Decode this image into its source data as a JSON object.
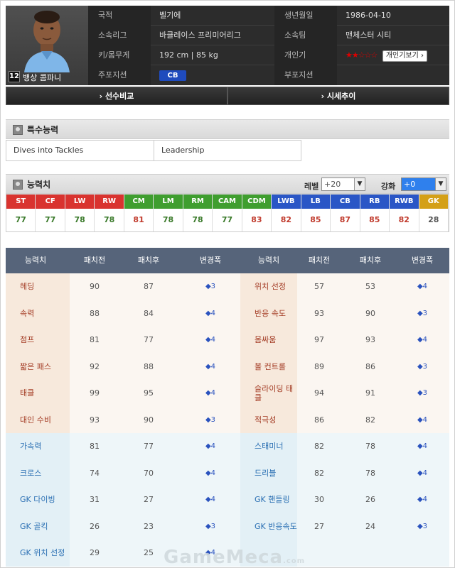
{
  "player": {
    "number": "12",
    "name": "뱅상 콤파니",
    "rows": [
      {
        "label1": "국적",
        "value1": "벨기에",
        "label2": "생년월일",
        "value2": "1986-04-10"
      },
      {
        "label1": "소속리그",
        "value1": "바클레이스 프리미어리그",
        "label2": "소속팀",
        "value2": "맨체스터 시티"
      },
      {
        "label1": "키/몸무게",
        "value1": "192 cm  |  85 kg",
        "label2": "개인기",
        "value2": ""
      },
      {
        "label1": "주포지션",
        "value1": "CB",
        "label2": "부포지션",
        "value2": ""
      }
    ],
    "skill_stars": {
      "filled": "★★",
      "empty": "☆☆☆"
    },
    "personal_skill_button": "개인기보기 ›",
    "compare_button": "› 선수비교",
    "price_button": "› 시세추이"
  },
  "special": {
    "title": "특수능력",
    "items": [
      "Dives into Tackles",
      "Leadership"
    ]
  },
  "ability": {
    "title": "능력치",
    "level_label": "레벨",
    "level_value": "+20",
    "enhance_label": "강화",
    "enhance_value": "+0",
    "positions": [
      {
        "pos": "ST",
        "val": "77",
        "color": "#d9332f",
        "valcolor": "#3a7a2a"
      },
      {
        "pos": "CF",
        "val": "77",
        "color": "#d9332f",
        "valcolor": "#3a7a2a"
      },
      {
        "pos": "LW",
        "val": "78",
        "color": "#d9332f",
        "valcolor": "#3a7a2a"
      },
      {
        "pos": "RW",
        "val": "78",
        "color": "#d9332f",
        "valcolor": "#3a7a2a"
      },
      {
        "pos": "CM",
        "val": "81",
        "color": "#3f9e2f",
        "valcolor": "#c0392b"
      },
      {
        "pos": "LM",
        "val": "78",
        "color": "#3f9e2f",
        "valcolor": "#3a7a2a"
      },
      {
        "pos": "RM",
        "val": "78",
        "color": "#3f9e2f",
        "valcolor": "#3a7a2a"
      },
      {
        "pos": "CAM",
        "val": "77",
        "color": "#3f9e2f",
        "valcolor": "#3a7a2a"
      },
      {
        "pos": "CDM",
        "val": "83",
        "color": "#3f9e2f",
        "valcolor": "#c0392b"
      },
      {
        "pos": "LWB",
        "val": "82",
        "color": "#2a56c6",
        "valcolor": "#c0392b"
      },
      {
        "pos": "LB",
        "val": "85",
        "color": "#2a56c6",
        "valcolor": "#c0392b"
      },
      {
        "pos": "CB",
        "val": "87",
        "color": "#2a56c6",
        "valcolor": "#c0392b"
      },
      {
        "pos": "RB",
        "val": "85",
        "color": "#2a56c6",
        "valcolor": "#c0392b"
      },
      {
        "pos": "RWB",
        "val": "82",
        "color": "#2a56c6",
        "valcolor": "#c0392b"
      },
      {
        "pos": "GK",
        "val": "28",
        "color": "#d4a017",
        "valcolor": "#555555"
      }
    ]
  },
  "stats": {
    "headers": [
      "능력치",
      "패치전",
      "패치후",
      "변경폭",
      "능력치",
      "패치전",
      "패치후",
      "변경폭"
    ],
    "rows": [
      {
        "l": [
          "헤딩",
          "90",
          "87",
          "◆3"
        ],
        "r": [
          "위치 선정",
          "57",
          "53",
          "◆4"
        ],
        "group": "a"
      },
      {
        "l": [
          "속력",
          "88",
          "84",
          "◆4"
        ],
        "r": [
          "반응 속도",
          "93",
          "90",
          "◆3"
        ],
        "group": "a"
      },
      {
        "l": [
          "점프",
          "81",
          "77",
          "◆4"
        ],
        "r": [
          "몸싸움",
          "97",
          "93",
          "◆4"
        ],
        "group": "a"
      },
      {
        "l": [
          "짧은 패스",
          "92",
          "88",
          "◆4"
        ],
        "r": [
          "볼 컨트롤",
          "89",
          "86",
          "◆3"
        ],
        "group": "a"
      },
      {
        "l": [
          "태클",
          "99",
          "95",
          "◆4"
        ],
        "r": [
          "슬라이딩 태클",
          "94",
          "91",
          "◆3"
        ],
        "group": "a"
      },
      {
        "l": [
          "대인 수비",
          "93",
          "90",
          "◆3"
        ],
        "r": [
          "적극성",
          "86",
          "82",
          "◆4"
        ],
        "group": "a"
      },
      {
        "l": [
          "가속력",
          "81",
          "77",
          "◆4"
        ],
        "r": [
          "스태미너",
          "82",
          "78",
          "◆4"
        ],
        "group": "b"
      },
      {
        "l": [
          "크로스",
          "74",
          "70",
          "◆4"
        ],
        "r": [
          "드리블",
          "82",
          "78",
          "◆4"
        ],
        "group": "b"
      },
      {
        "l": [
          "GK 다이빙",
          "31",
          "27",
          "◆4"
        ],
        "r": [
          "GK 핸들링",
          "30",
          "26",
          "◆4"
        ],
        "group": "b"
      },
      {
        "l": [
          "GK 골킥",
          "26",
          "23",
          "◆3"
        ],
        "r": [
          "GK 반응속도",
          "27",
          "24",
          "◆3"
        ],
        "group": "b"
      },
      {
        "l": [
          "GK 위치 선정",
          "29",
          "25",
          "◆4"
        ],
        "r": [
          "",
          "",
          "",
          ""
        ],
        "group": "b"
      }
    ]
  },
  "watermark": {
    "text": "GameMeca",
    "suffix": ".com"
  },
  "colors": {
    "header_bg": "#56647a",
    "group_a_label": "#a33b24",
    "group_b_label": "#2a6fb3"
  }
}
